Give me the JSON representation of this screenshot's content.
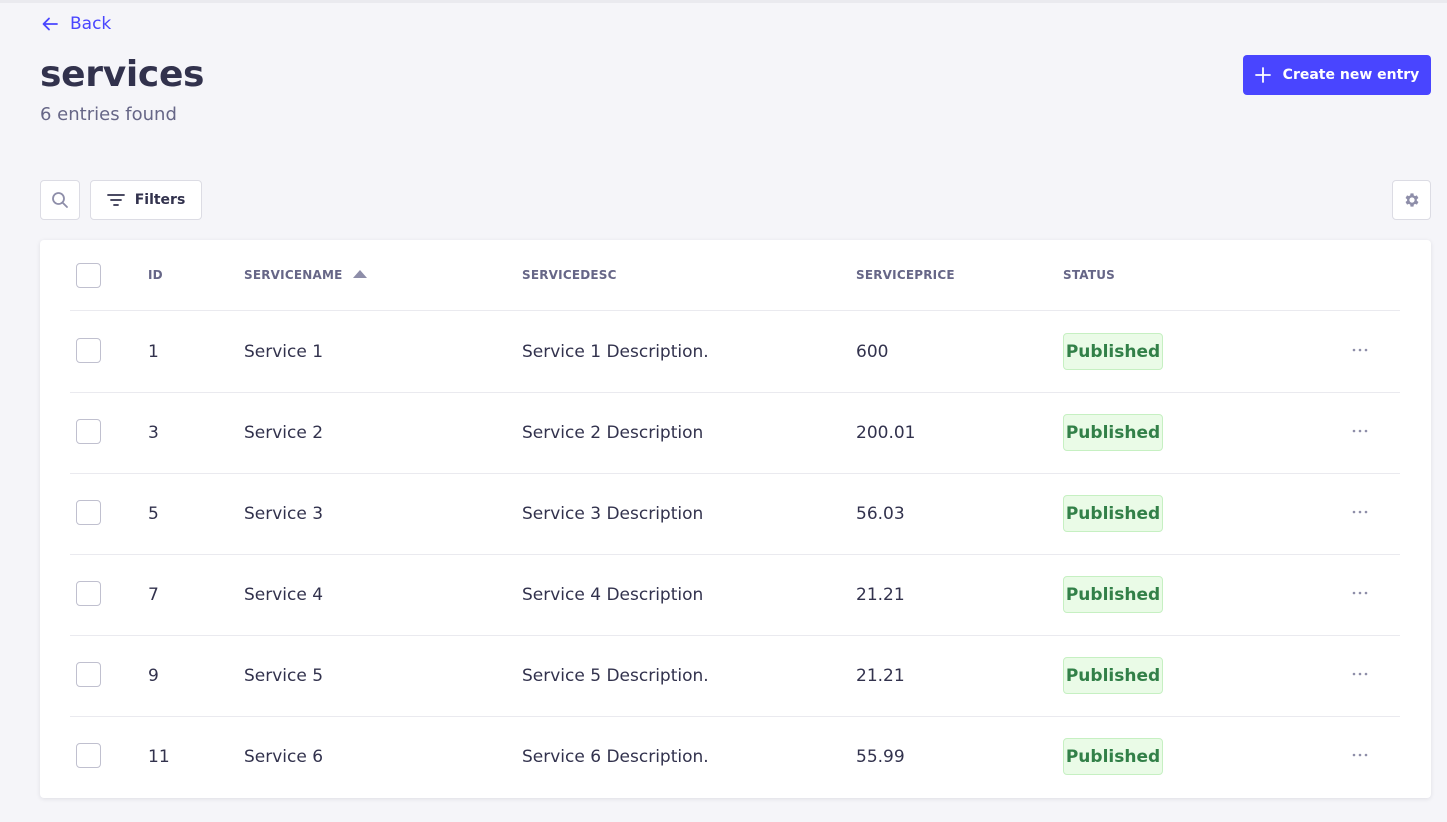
{
  "header": {
    "back_label": "Back",
    "title": "services",
    "subtitle": "6 entries found",
    "create_label": "Create new entry"
  },
  "toolbar": {
    "filters_label": "Filters"
  },
  "table": {
    "columns": [
      "ID",
      "SERVICENAME",
      "SERVICEDESC",
      "SERVICEPRICE",
      "STATUS"
    ],
    "sorted_column": "SERVICENAME",
    "sort_direction": "ascending",
    "rows": [
      {
        "id": "1",
        "name": "Service 1",
        "desc": "Service 1 Description.",
        "price": "600",
        "status": "Published"
      },
      {
        "id": "3",
        "name": "Service 2",
        "desc": "Service 2 Description",
        "price": "200.01",
        "status": "Published"
      },
      {
        "id": "5",
        "name": "Service 3",
        "desc": "Service 3 Description",
        "price": "56.03",
        "status": "Published"
      },
      {
        "id": "7",
        "name": "Service 4",
        "desc": "Service 4 Description",
        "price": "21.21",
        "status": "Published"
      },
      {
        "id": "9",
        "name": "Service 5",
        "desc": "Service 5 Description.",
        "price": "21.21",
        "status": "Published"
      },
      {
        "id": "11",
        "name": "Service 6",
        "desc": "Service 6 Description.",
        "price": "55.99",
        "status": "Published"
      }
    ]
  },
  "icons": {
    "back": "arrow-left-icon",
    "create": "plus-icon",
    "search": "search-icon",
    "filters": "filter-icon",
    "settings": "gear-icon",
    "row_actions": "more-horizontal-icon"
  },
  "colors": {
    "primary": "#4945ff",
    "published_bg": "#eafbe7",
    "published_text": "#328048",
    "page_bg": "#f5f5f9"
  }
}
